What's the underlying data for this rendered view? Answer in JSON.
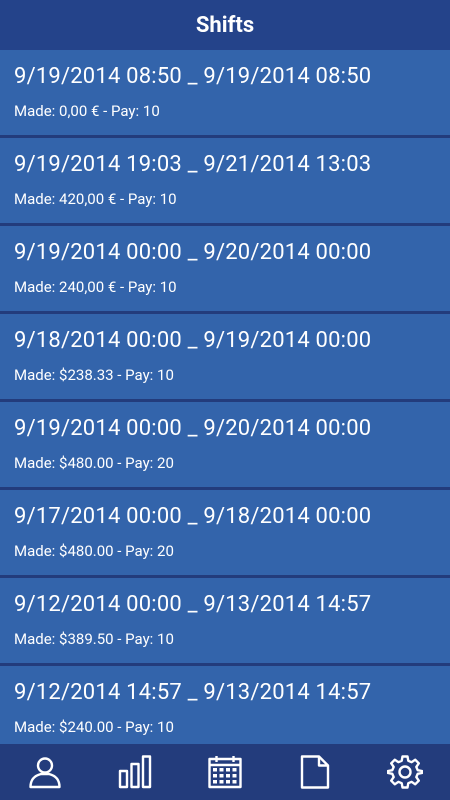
{
  "header": {
    "title": "Shifts"
  },
  "shifts": [
    {
      "range": "9/19/2014 08:50 _ 9/19/2014 08:50",
      "made": "Made: 0,00 € - Pay: 10"
    },
    {
      "range": "9/19/2014 19:03 _ 9/21/2014 13:03",
      "made": "Made: 420,00 € - Pay: 10"
    },
    {
      "range": "9/19/2014 00:00 _ 9/20/2014 00:00",
      "made": "Made: 240,00 € - Pay: 10"
    },
    {
      "range": "9/18/2014 00:00 _ 9/19/2014 00:00",
      "made": "Made: $238.33 - Pay: 10"
    },
    {
      "range": "9/19/2014 00:00 _ 9/20/2014 00:00",
      "made": "Made: $480.00 - Pay: 20"
    },
    {
      "range": "9/17/2014 00:00 _ 9/18/2014 00:00",
      "made": "Made: $480.00 - Pay: 20"
    },
    {
      "range": "9/12/2014 00:00 _ 9/13/2014 14:57",
      "made": "Made: $389.50 - Pay: 10"
    },
    {
      "range": "9/12/2014 14:57 _ 9/13/2014 14:57",
      "made": "Made: $240.00 - Pay: 10"
    }
  ],
  "nav": {
    "items": [
      {
        "icon": "person-icon"
      },
      {
        "icon": "bar-chart-icon"
      },
      {
        "icon": "calendar-icon"
      },
      {
        "icon": "document-icon"
      },
      {
        "icon": "gear-icon"
      }
    ]
  }
}
